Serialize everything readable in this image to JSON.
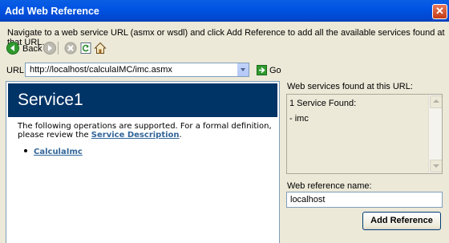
{
  "window": {
    "title": "Add Web Reference"
  },
  "instructions": "Navigate to a web service URL (asmx or wsdl) and click Add Reference to add all the available services found at that URL.",
  "toolbar": {
    "back_label": "Back",
    "icons": [
      "back-icon",
      "forward-icon",
      "stop-icon",
      "refresh-icon",
      "home-icon"
    ]
  },
  "url_bar": {
    "label": "URL:",
    "value": "http://localhost/calculaIMC/imc.asmx",
    "go_label": "Go"
  },
  "browser": {
    "service_title": "Service1",
    "description_text": "The following operations are supported. For a formal definition, please review the ",
    "description_link": "Service Description",
    "description_end": ".",
    "operations": [
      "CalculaImc"
    ]
  },
  "services_panel": {
    "label": "Web services found at this URL:",
    "found_text": "1 Service Found:",
    "services": [
      "- imc"
    ]
  },
  "reference": {
    "label": "Web reference name:",
    "value": "localhost",
    "add_button": "Add Reference"
  },
  "colors": {
    "titlebar": "#0054e3",
    "service_header": "#003366",
    "link": "#336699",
    "dialog_bg": "#ece9d8"
  }
}
